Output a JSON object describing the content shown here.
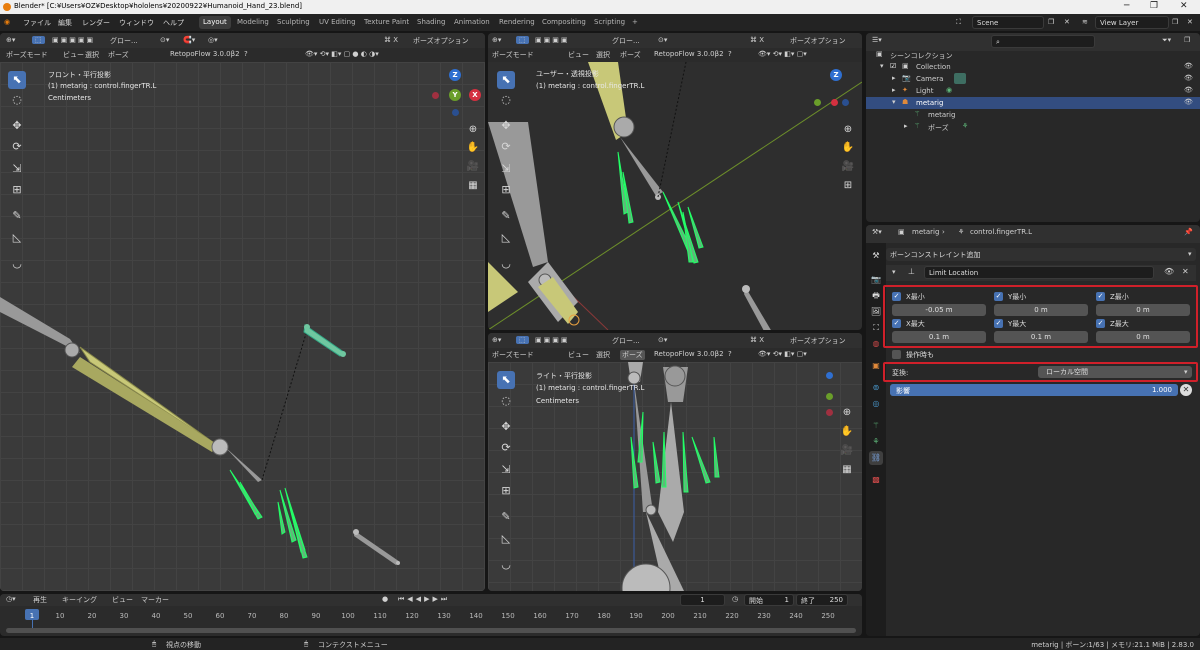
{
  "window": {
    "title": "Blender* [C:¥Users¥OZ¥Desktop¥hololens¥20200922¥Humanoid_Hand_23.blend]"
  },
  "menubar": [
    "ファイル",
    "編集",
    "レンダー",
    "ウィンドウ",
    "ヘルプ"
  ],
  "workspaces": [
    "Layout",
    "Modeling",
    "Sculpting",
    "UV Editing",
    "Texture Paint",
    "Shading",
    "Animation",
    "Rendering",
    "Compositing",
    "Scripting"
  ],
  "active_workspace": "Layout",
  "scene": "Scene",
  "view_layer": "View Layer",
  "viewport_header": {
    "mode": "ポーズモード",
    "menus": [
      "ビュー",
      "選択",
      "ポーズ"
    ],
    "addon": "RetopoFlow 3.0.0β2",
    "transform": "グロー...",
    "options": "ポーズオプション"
  },
  "viewports": {
    "front": {
      "view": "フロント・平行投影",
      "object": "(1) metarig : control.fingerTR.L",
      "units": "Centimeters"
    },
    "user": {
      "view": "ユーザー・透視投影",
      "object": "(1) metarig : control.fingerTR.L"
    },
    "right": {
      "view": "ライト・平行投影",
      "object": "(1) metarig : control.fingerTR.L",
      "units": "Centimeters"
    }
  },
  "gizmo_axes": {
    "z": "Z",
    "y": "Y",
    "x": "X"
  },
  "outliner": {
    "search_placeholder": "",
    "root": "シーンコレクション",
    "items": [
      {
        "label": "Collection"
      },
      {
        "label": "Camera"
      },
      {
        "label": "Light"
      },
      {
        "label": "metarig"
      },
      {
        "label": "metarig"
      },
      {
        "label": "ポーズ"
      }
    ]
  },
  "properties": {
    "breadcrumb_object": "metarig",
    "breadcrumb_bone": "control.fingerTR.L",
    "add_constraint": "ボーンコンストレイント追加",
    "constraint_name": "Limit Location",
    "min": {
      "x": "X最小",
      "y": "Y最小",
      "z": "Z最小",
      "x_val": "-0.05 m",
      "y_val": "0 m",
      "z_val": "0 m"
    },
    "max": {
      "x": "X最大",
      "y": "Y最大",
      "z": "Z最大",
      "x_val": "0.1 m",
      "y_val": "0.1 m",
      "z_val": "0 m"
    },
    "affect_transform": "操作時も",
    "convert_label": "変換:",
    "convert_value": "ローカル空間",
    "influence_label": "影響",
    "influence_value": "1.000",
    "influence": 1.0
  },
  "timeline": {
    "menus": [
      "再生",
      "キーイング",
      "ビュー",
      "マーカー"
    ],
    "current_frame": "1",
    "start_label": "開始",
    "start": "1",
    "end_label": "終了",
    "end": "250",
    "ticks": [
      "1",
      "10",
      "20",
      "30",
      "40",
      "50",
      "60",
      "70",
      "80",
      "90",
      "100",
      "110",
      "120",
      "130",
      "140",
      "150",
      "160",
      "170",
      "180",
      "190",
      "200",
      "210",
      "220",
      "230",
      "240",
      "250"
    ]
  },
  "statusbar": {
    "left": "視点の移動",
    "middle": "コンテクストメニュー",
    "right": "metarig | ボーン:1/63 | メモリ:21.1 MiB | 2.83.0"
  },
  "colors": {
    "accent": "#4772b3",
    "highlight": "#d0202a",
    "bone_yellow": "#c8c878",
    "bone_green": "#5fb87a"
  }
}
